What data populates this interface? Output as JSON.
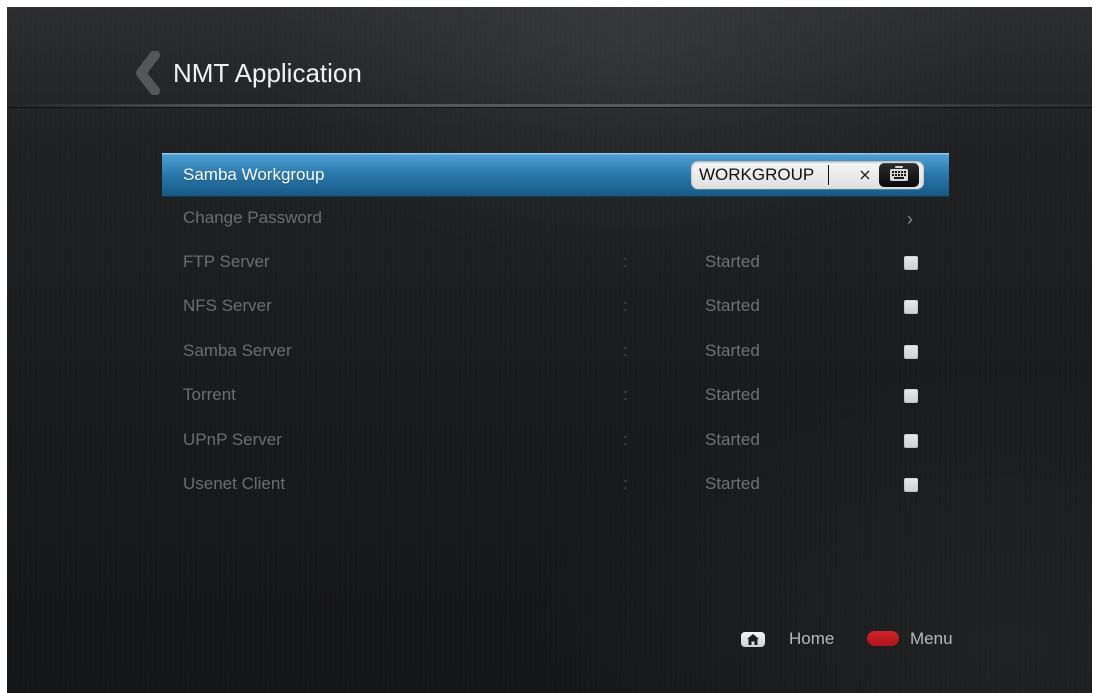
{
  "header": {
    "back_icon": "chevron-left-icon",
    "title": "NMT Application"
  },
  "settings": {
    "samba_workgroup": {
      "label": "Samba Workgroup",
      "value": "WORKGROUP",
      "clear_label": "×",
      "clear_icon": "close-icon",
      "keyboard_icon": "keyboard-icon"
    },
    "change_password": {
      "label": "Change Password",
      "arrow_label": "›",
      "arrow_icon": "chevron-right-icon"
    },
    "services": [
      {
        "label": "FTP Server",
        "separator": ":",
        "status": "Started",
        "enabled": true
      },
      {
        "label": "NFS Server",
        "separator": ":",
        "status": "Started",
        "enabled": true
      },
      {
        "label": "Samba Server",
        "separator": ":",
        "status": "Started",
        "enabled": true
      },
      {
        "label": "Torrent",
        "separator": ":",
        "status": "Started",
        "enabled": true
      },
      {
        "label": "UPnP Server",
        "separator": ":",
        "status": "Started",
        "enabled": true
      },
      {
        "label": "Usenet Client",
        "separator": ":",
        "status": "Started",
        "enabled": true
      }
    ]
  },
  "footer": {
    "home": {
      "label": "Home",
      "icon": "home-icon"
    },
    "menu": {
      "label": "Menu",
      "icon": "red-button-icon"
    }
  },
  "colors": {
    "selection_blue": "#2a79ad",
    "menu_red": "#c21d23",
    "dim_text": "#6c6d70",
    "title_text": "#f1f1f1"
  }
}
